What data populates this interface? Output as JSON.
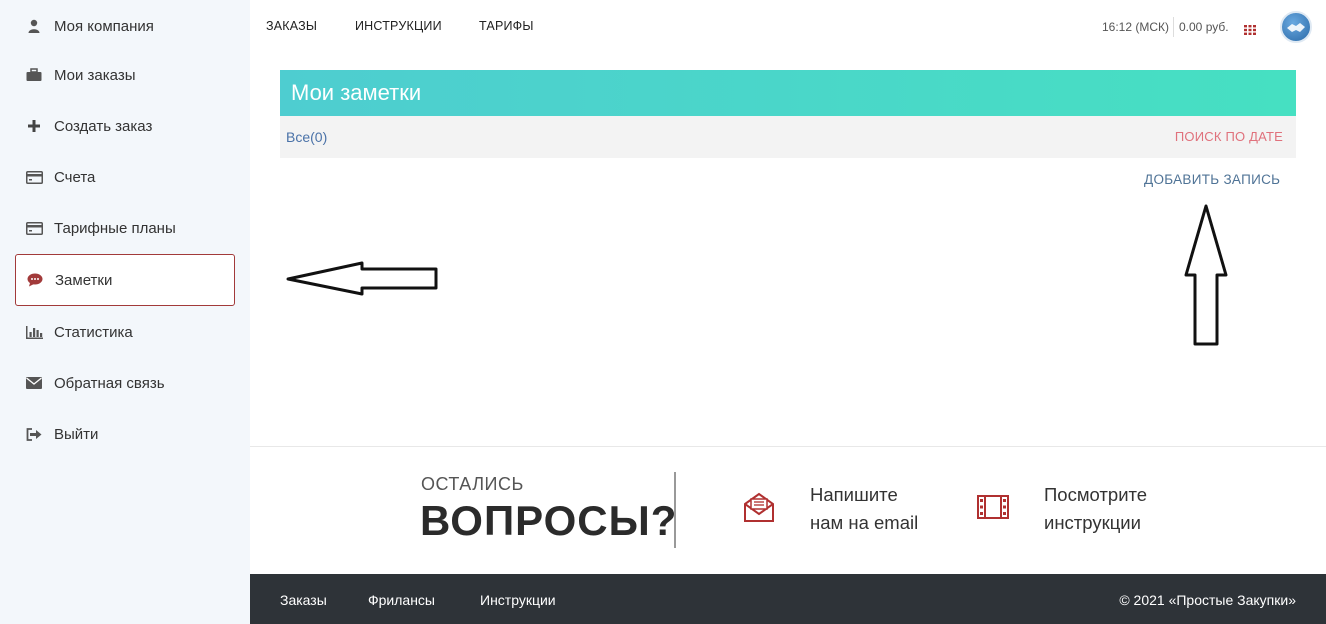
{
  "sidebar": {
    "items": [
      {
        "label": "Моя компания",
        "icon": "user-icon"
      },
      {
        "label": "Мои заказы",
        "icon": "briefcase-icon"
      },
      {
        "label": "Создать заказ",
        "icon": "plus-icon"
      },
      {
        "label": "Счета",
        "icon": "credit-card-icon"
      },
      {
        "label": "Тарифные планы",
        "icon": "credit-card-icon"
      },
      {
        "label": "Заметки",
        "icon": "comment-icon",
        "active": true
      },
      {
        "label": "Статистика",
        "icon": "bar-chart-icon"
      },
      {
        "label": "Обратная связь",
        "icon": "envelope-icon"
      },
      {
        "label": "Выйти",
        "icon": "sign-out-icon"
      }
    ]
  },
  "topnav": {
    "links": [
      "ЗАКАЗЫ",
      "ИНСТРУКЦИИ",
      "ТАРИФЫ"
    ],
    "time": "16:12 (МСК)",
    "balance": "0.00 руб.",
    "grid_icon": "grid-icon",
    "logo_icon": "handshake-logo-icon"
  },
  "notes": {
    "title": "Мои заметки",
    "filter_all": "Все(0)",
    "search_by_date": "ПОИСК ПО ДАТЕ",
    "add_record": "ДОБАВИТЬ ЗАПИСЬ"
  },
  "questions": {
    "small": "ОСТАЛИСЬ",
    "big": "ВОПРОСЫ?",
    "email": {
      "line1": "Напишите",
      "line2": "нам на email",
      "icon": "envelope-open-icon"
    },
    "instructions": {
      "line1": "Посмотрите",
      "line2": "инструкции",
      "icon": "film-icon"
    }
  },
  "footer": {
    "links": [
      "Заказы",
      "Фрилансы",
      "Инструкции"
    ],
    "copyright": "© 2021 «Простые Закупки»"
  },
  "colors": {
    "accent_red": "#a23a3a",
    "header_gradient_start": "#4ecdd0",
    "header_gradient_end": "#46e0c2",
    "link_blue": "#4a72a8",
    "date_search_pink": "#e0717c",
    "footer_bg": "#2e3338",
    "sidebar_bg": "#f3f7fb"
  }
}
